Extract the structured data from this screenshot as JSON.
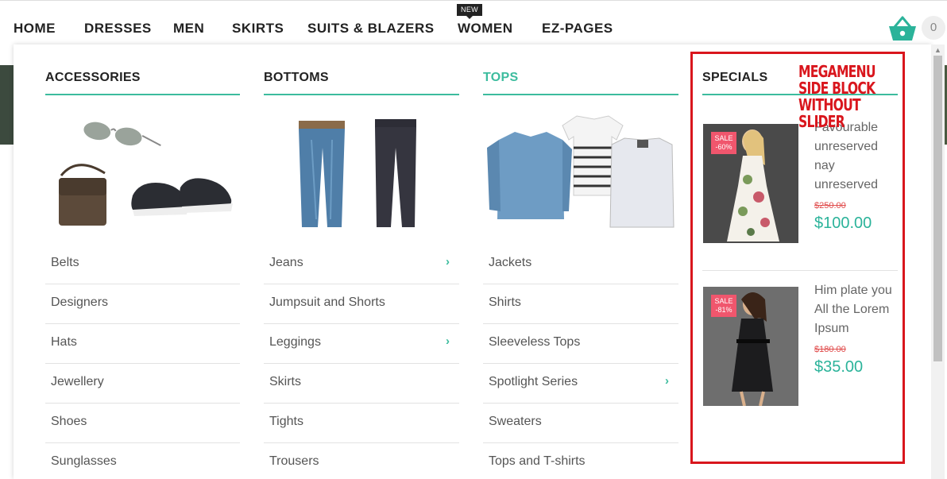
{
  "nav": {
    "items": [
      "HOME",
      "DRESSES",
      "MEN",
      "SKIRTS",
      "SUITS & BLAZERS",
      "WOMEN",
      "EZ-PAGES"
    ],
    "new_badge": "NEW",
    "cart_count": "0"
  },
  "columns": [
    {
      "title": "ACCESSORIES",
      "image": "accessories-image",
      "links": [
        {
          "label": "Belts",
          "has_submenu": false
        },
        {
          "label": "Designers",
          "has_submenu": false
        },
        {
          "label": "Hats",
          "has_submenu": false
        },
        {
          "label": "Jewellery",
          "has_submenu": false
        },
        {
          "label": "Shoes",
          "has_submenu": false
        },
        {
          "label": "Sunglasses",
          "has_submenu": false
        }
      ]
    },
    {
      "title": "BOTTOMS",
      "image": "bottoms-image",
      "links": [
        {
          "label": "Jeans",
          "has_submenu": true
        },
        {
          "label": "Jumpsuit and Shorts",
          "has_submenu": false
        },
        {
          "label": "Leggings",
          "has_submenu": true
        },
        {
          "label": "Skirts",
          "has_submenu": false
        },
        {
          "label": "Tights",
          "has_submenu": false
        },
        {
          "label": "Trousers",
          "has_submenu": false
        }
      ]
    },
    {
      "title": "TOPS",
      "image": "tops-image",
      "links": [
        {
          "label": "Jackets",
          "has_submenu": false
        },
        {
          "label": "Shirts",
          "has_submenu": false
        },
        {
          "label": "Sleeveless Tops",
          "has_submenu": false
        },
        {
          "label": "Spotlight Series",
          "has_submenu": true
        },
        {
          "label": "Sweaters",
          "has_submenu": false
        },
        {
          "label": "Tops and T-shirts",
          "has_submenu": false
        }
      ]
    }
  ],
  "specials": {
    "title": "SPECIALS",
    "annotation": [
      "MEGAMENU",
      "SIDE BLOCK",
      "WITHOUT",
      "SLIDER"
    ],
    "products": [
      {
        "sale_label": "SALE",
        "discount": "-60%",
        "name": "Favourable unreserved nay unreserved",
        "old_price": "$250.00",
        "price": "$100.00"
      },
      {
        "sale_label": "SALE",
        "discount": "-81%",
        "name": "Him plate you All the Lorem Ipsum",
        "old_price": "$180.00",
        "price": "$35.00"
      }
    ]
  },
  "colors": {
    "accent": "#3cbc9e",
    "price": "#2bb39a",
    "sale_badge": "#f0566d",
    "annotation": "#d9161d"
  },
  "icons": {
    "cart": "basket-icon",
    "submenu": "chevron-right-icon"
  }
}
